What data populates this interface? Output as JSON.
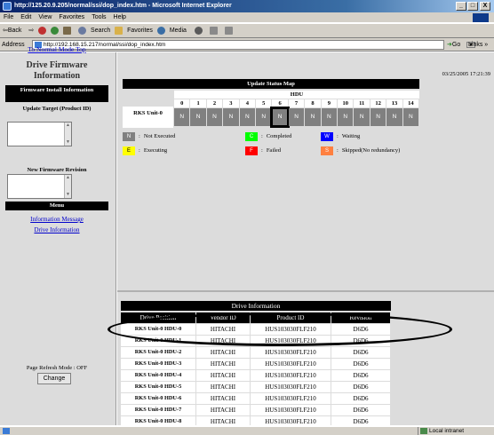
{
  "window": {
    "title": "http://125.20.9.205/normal/ssi/dop_index.htm - Microsoft Internet Explorer",
    "buttons": [
      "_",
      "□",
      "X"
    ]
  },
  "menubar": [
    "File",
    "Edit",
    "View",
    "Favorites",
    "Tools",
    "Help"
  ],
  "toolbar": {
    "back": "⇦Back",
    "forward": "⇨",
    "search": "Search",
    "favorites": "Favorites",
    "media": "Media"
  },
  "address": {
    "label": "Address",
    "url": "http://192.168.15.217/normal/ssi/dop_index.htm",
    "go": "Go",
    "links": "Links »"
  },
  "left": {
    "to_normal_link": "To Normal Mode Top",
    "fw_title": "Drive Firmware Information",
    "fw_install": "Firmware Install Information",
    "update_target": "Update Target (Product ID)",
    "new_firmware": "New Firmware Revision",
    "menu": "Menu",
    "info_message_link": "Information Message",
    "drive_info_link": "Drive Information",
    "refresh_mode": "Page Refresh Mode : OFF",
    "change_button": "Change"
  },
  "status_map": {
    "timestamp": "03/25/2005 17:21:39",
    "title": "Update Status Map",
    "hdu_label": "HDU",
    "hdu_numbers": [
      "0",
      "1",
      "2",
      "3",
      "4",
      "5",
      "6",
      "7",
      "8",
      "9",
      "10",
      "11",
      "12",
      "13",
      "14"
    ],
    "row_label": "RKS Unit-0",
    "cells": [
      "N",
      "N",
      "N",
      "N",
      "N",
      "N",
      "N",
      "N",
      "N",
      "N",
      "N",
      "N",
      "N",
      "N",
      "N"
    ],
    "highlighted_index": 6
  },
  "legend": [
    {
      "code": "N",
      "label": "Not Executed",
      "color": "#808080",
      "text_color": "#ffffff"
    },
    {
      "code": "C",
      "label": "Completed",
      "color": "#00ff00",
      "text_color": "#ffffff"
    },
    {
      "code": "W",
      "label": "Waiting",
      "color": "#0000ff",
      "text_color": "#ffffff"
    },
    {
      "code": "E",
      "label": "Executing",
      "color": "#ffff00",
      "text_color": "#000000"
    },
    {
      "code": "F",
      "label": "Failed",
      "color": "#ff0000",
      "text_color": "#ffffff"
    },
    {
      "code": "S",
      "label": "Skipped(No redundancy)",
      "color": "#ff8040",
      "text_color": "#ffffff"
    }
  ],
  "drive_info": {
    "title": "Drive Information",
    "headers": [
      "Drive Position",
      "Vendor ID",
      "Product ID",
      "Revision"
    ],
    "rows": [
      [
        "RKS Unit-0 HDU-0",
        "HITACHI",
        "HUS103030FLF210",
        "D6D6"
      ],
      [
        "RKS Unit-0 HDU-1",
        "HITACHI",
        "HUS103030FLF210",
        "D6D6"
      ],
      [
        "RKS Unit-0 HDU-2",
        "HITACHI",
        "HUS103030FLF210",
        "D6D6"
      ],
      [
        "RKS Unit-0 HDU-3",
        "HITACHI",
        "HUS103030FLF210",
        "D6D6"
      ],
      [
        "RKS Unit-0 HDU-4",
        "HITACHI",
        "HUS103030FLF210",
        "D6D6"
      ],
      [
        "RKS Unit-0 HDU-5",
        "HITACHI",
        "HUS103030FLF210",
        "D6D6"
      ],
      [
        "RKS Unit-0 HDU-6",
        "HITACHI",
        "HUS103030FLF210",
        "D6D6"
      ],
      [
        "RKS Unit-0 HDU-7",
        "HITACHI",
        "HUS103030FLF210",
        "D6D6"
      ],
      [
        "RKS Unit-0 HDU-8",
        "HITACHI",
        "HUS103030FLF210",
        "D6D6"
      ]
    ]
  },
  "statusbar": {
    "zone": "Local intranet"
  }
}
